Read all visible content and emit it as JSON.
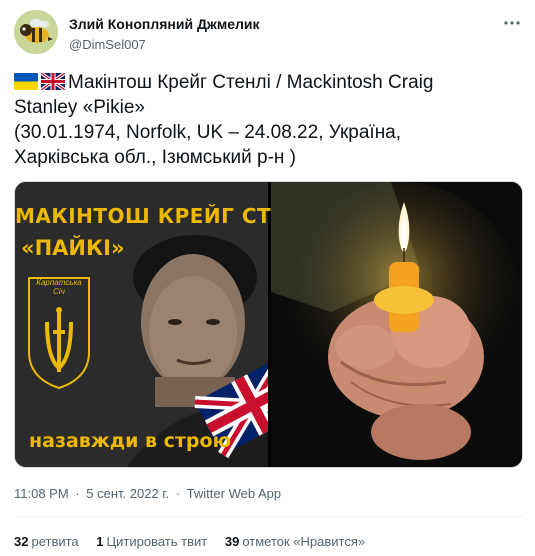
{
  "author": {
    "display_name": "Злий Конопляний Джмелик",
    "handle": "@DimSel007",
    "avatar_icon": "bee-avatar"
  },
  "tweet": {
    "flags": [
      "ukraine-flag",
      "uk-flag"
    ],
    "line1": "Макінтош Крейг Стенлі / Mackintosh Craig",
    "line2": "Stanley «Pikie»",
    "line3": "(30.01.1974, Norfolk, UK – 24.08.22, Україна,",
    "line4": "Харківська обл., Ізюмський р-н  )"
  },
  "media": {
    "poster_title": "МАКІНТОШ КРЕЙГ СТЕНЛІ",
    "poster_nick": "«ПАЙКІ»",
    "poster_emblem": "Карпатська Січ",
    "poster_bottom": "назавжди в строю"
  },
  "meta": {
    "time": "11:08 PM",
    "date": "5 сент. 2022 г.",
    "app": "Twitter Web App",
    "separator": "·"
  },
  "stats": {
    "retweets_count": "32",
    "retweets_label": "ретвита",
    "quotes_count": "1",
    "quotes_label": "Цитировать твит",
    "likes_count": "39",
    "likes_label": "отметок «Нравится»"
  },
  "colors": {
    "text": "#0f1419",
    "secondary": "#536471",
    "poster_yellow": "#ecb800",
    "border": "#cfd9de"
  }
}
